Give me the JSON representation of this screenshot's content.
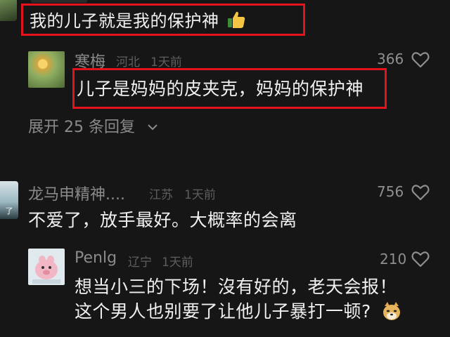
{
  "comment_top": {
    "text": "我的儿子就是我的保护神",
    "emoji": "thumbs-up-icon"
  },
  "reply_hanmei": {
    "username": "寒梅",
    "location": "河北",
    "time": "1天前",
    "likes": "366",
    "text": "儿子是妈妈的皮夹克，妈妈的保护神"
  },
  "expand_replies": {
    "label": "展开 25 条回复"
  },
  "comment_longma": {
    "username": "龙马申精神....",
    "location": "江苏",
    "time": "1天前",
    "likes": "756",
    "text": "不爱了，放手最好。大概率的会离"
  },
  "reply_penlg": {
    "username": "Penlg",
    "location": "辽宁",
    "time": "1天前",
    "likes": "210",
    "text_line1": "想当小三的下场！沒有好的，老天会报！",
    "text_line2": "这个男人也别要了让他儿子暴打一顿?",
    "emoji": "doge-icon"
  },
  "colors": {
    "background": "#161616",
    "highlight_box": "#e3121b",
    "text": "#f0f0f0",
    "meta": "#5e5e5e"
  }
}
